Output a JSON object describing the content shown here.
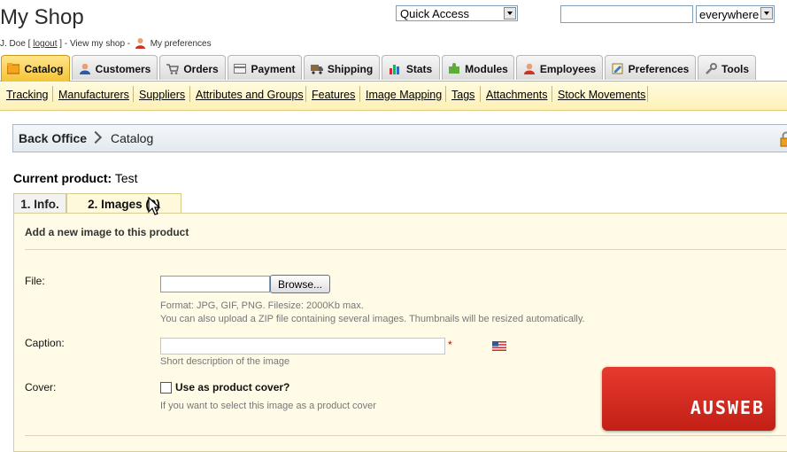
{
  "header": {
    "shop_title": "My Shop",
    "user_name": "J. Doe [",
    "logout": "logout",
    "user_mid": "] - View my shop -",
    "preferences": "My preferences",
    "quick_access": "Quick Access",
    "search_value": "",
    "search_scope": "everywhere"
  },
  "tabs": [
    {
      "label": "Catalog",
      "icon": "catalog-icon"
    },
    {
      "label": "Customers",
      "icon": "customers-icon"
    },
    {
      "label": "Orders",
      "icon": "orders-icon"
    },
    {
      "label": "Payment",
      "icon": "payment-icon"
    },
    {
      "label": "Shipping",
      "icon": "shipping-icon"
    },
    {
      "label": "Stats",
      "icon": "stats-icon"
    },
    {
      "label": "Modules",
      "icon": "modules-icon"
    },
    {
      "label": "Employees",
      "icon": "employees-icon"
    },
    {
      "label": "Preferences",
      "icon": "preferences-icon"
    },
    {
      "label": "Tools",
      "icon": "tools-icon"
    }
  ],
  "subnav": [
    "Tracking",
    "Manufacturers",
    "Suppliers",
    "Attributes and Groups",
    "Features",
    "Image Mapping",
    "Tags",
    "Attachments",
    "Stock Movements"
  ],
  "breadcrumb": {
    "home": "Back Office",
    "current": "Catalog"
  },
  "product": {
    "label": "Current product:",
    "name": "Test"
  },
  "product_tabs": {
    "info": "1. Info.",
    "images": "2. Images (0)"
  },
  "form": {
    "title": "Add a new image to this product",
    "file_label": "File:",
    "browse": "Browse...",
    "format_help": "Format: JPG, GIF, PNG. Filesize: 2000Kb max.",
    "zip_help": "You can also upload a ZIP file containing several images. Thumbnails will be resized automatically.",
    "caption_label": "Caption:",
    "caption_value": "",
    "required_mark": "*",
    "caption_help": "Short description of the image",
    "cover_label": "Cover:",
    "cover_checkbox": "Use as product cover?",
    "cover_help": "If you want to select this image as a product cover"
  },
  "logo": {
    "text": "AUSWEB"
  },
  "colors": {
    "active_tab": "#f5c436",
    "subnav_bg": "#fdf1b6",
    "panel_bg": "#fffbe6",
    "logo_bg": "#d42a20"
  }
}
